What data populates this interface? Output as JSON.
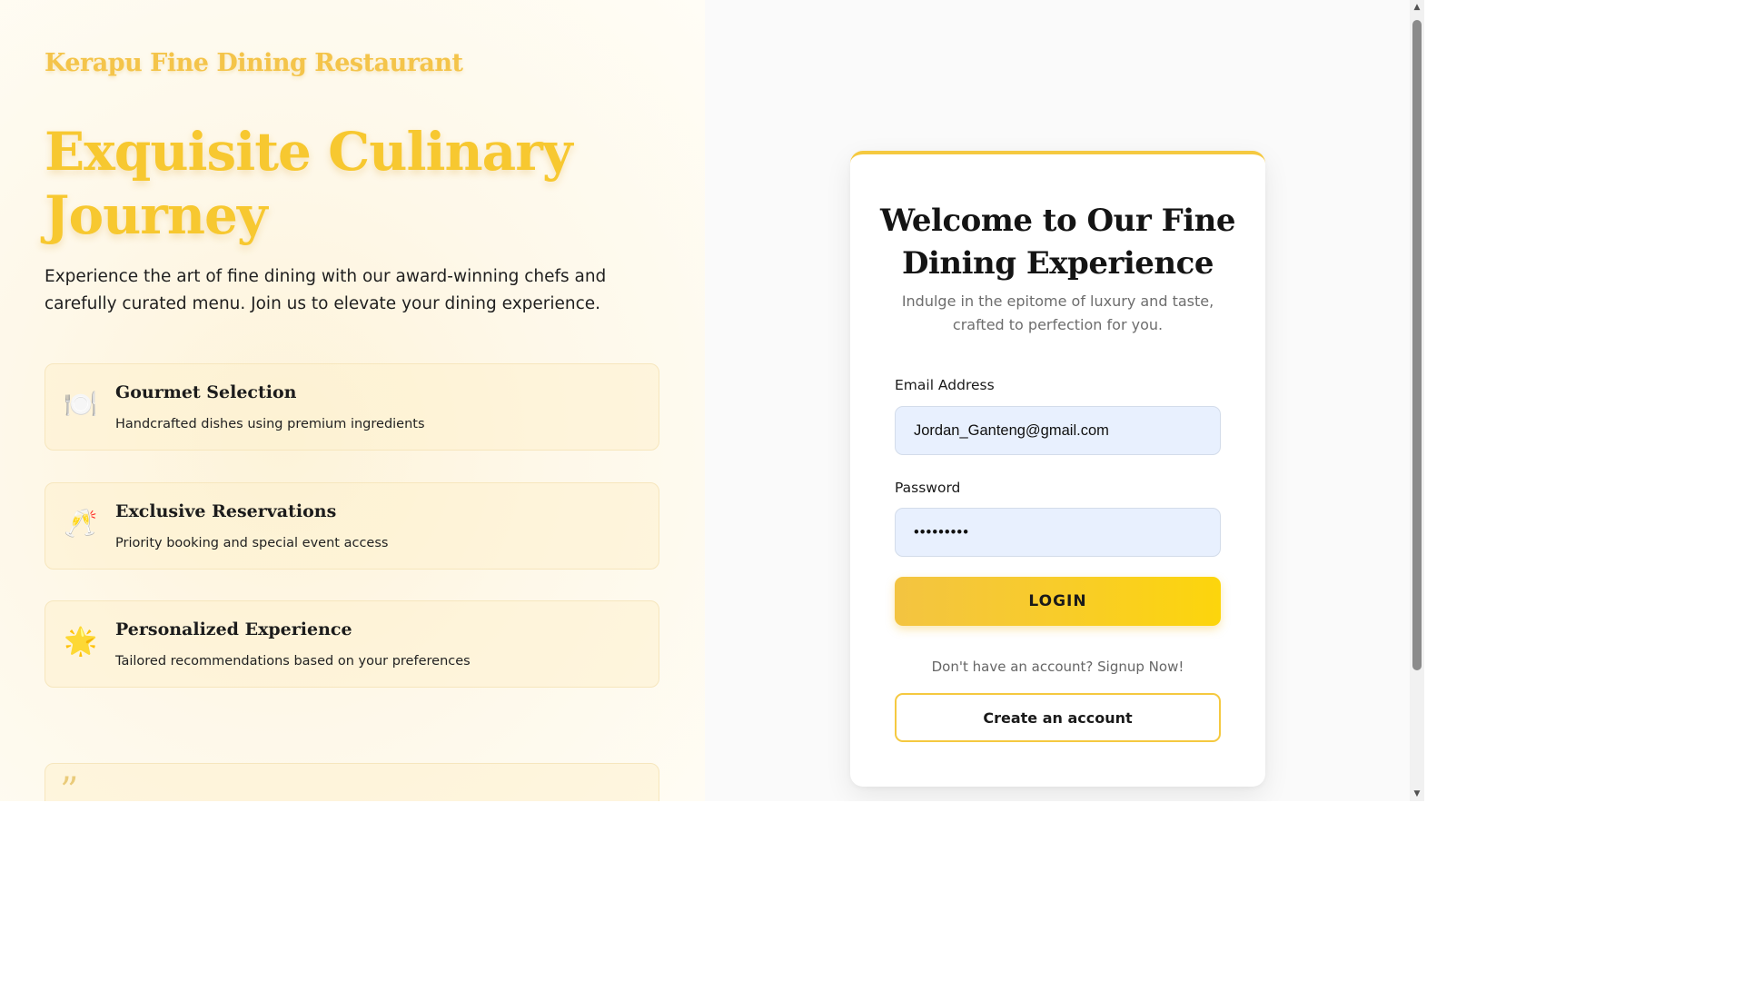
{
  "brand": "Kerapu Fine Dining Restaurant",
  "hero": {
    "title": "Exquisite Culinary Journey",
    "description": "Experience the art of fine dining with our award-winning chefs and carefully curated menu. Join us to elevate your dining experience."
  },
  "features": [
    {
      "icon": "plate-cutlery-icon",
      "glyph": "🍽️",
      "title": "Gourmet Selection",
      "description": "Handcrafted dishes using premium ingredients"
    },
    {
      "icon": "champagne-glasses-icon",
      "glyph": "🥂",
      "title": "Exclusive Reservations",
      "description": "Priority booking and special event access"
    },
    {
      "icon": "star-icon",
      "glyph": "🌟",
      "title": "Personalized Experience",
      "description": "Tailored recommendations based on your preferences"
    }
  ],
  "testimonial": {
    "icon": "quote-icon",
    "glyph": "”"
  },
  "login": {
    "title": "Welcome to Our Fine Dining Experience",
    "subtitle": "Indulge in the epitome of luxury and taste, crafted to perfection for you.",
    "email_label": "Email Address",
    "email_value": "Jordan_Ganteng@gmail.com",
    "password_label": "Password",
    "password_value": "•••••••••",
    "login_button": "LOGIN",
    "signup_prompt": "Don't have an account? Signup Now!",
    "create_button": "Create an account"
  },
  "scrollbar": {
    "up_glyph": "▲",
    "down_glyph": "▼"
  },
  "colors": {
    "accent": "#f5c940",
    "brand_text": "#f4c44a",
    "input_bg": "#e8f0fe"
  }
}
